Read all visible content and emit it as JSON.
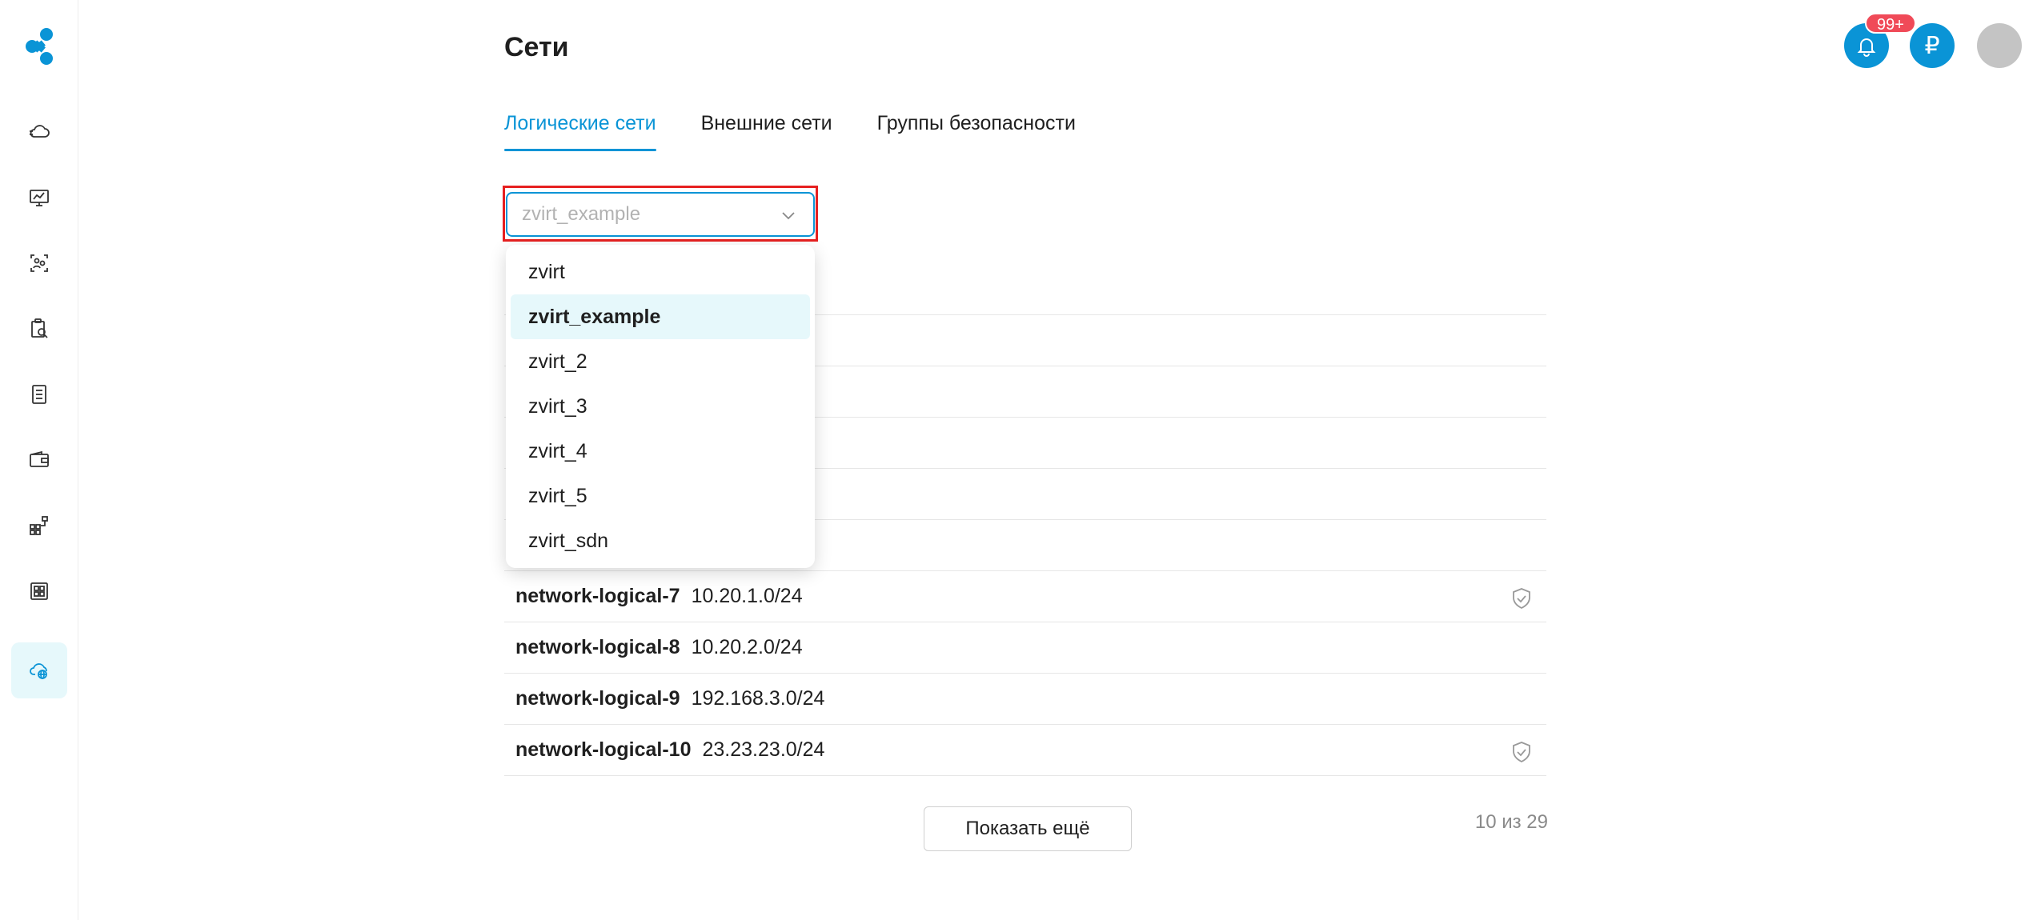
{
  "colors": {
    "accent": "#0a94d6",
    "badge": "#f04a58",
    "active_nav_bg": "#e6f8fb",
    "highlight": "#e62020"
  },
  "sidebar": {
    "logo_icon": "molecule-logo-icon",
    "items": [
      {
        "icon": "cloud-servers-icon"
      },
      {
        "icon": "monitor-dashboard-icon"
      },
      {
        "icon": "users-frame-icon"
      },
      {
        "icon": "clipboard-search-icon"
      },
      {
        "icon": "document-list-icon"
      },
      {
        "icon": "wallet-icon"
      },
      {
        "icon": "network-topology-icon"
      },
      {
        "icon": "grid-dashboard-icon"
      },
      {
        "icon": "cloud-globe-icon",
        "active": true
      }
    ]
  },
  "header": {
    "title": "Сети",
    "notifications_badge": "99+",
    "balance_symbol": "₽"
  },
  "tabs": [
    {
      "label": "Логические сети",
      "active": true
    },
    {
      "label": "Внешние сети",
      "active": false
    },
    {
      "label": "Группы безопасности",
      "active": false
    }
  ],
  "select": {
    "placeholder": "zvirt_example",
    "options": [
      "zvirt",
      "zvirt_example",
      "zvirt_2",
      "zvirt_3",
      "zvirt_4",
      "zvirt_5",
      "zvirt_sdn"
    ],
    "selected": "zvirt_example"
  },
  "networks": [
    {
      "name": "",
      "cidr": "",
      "shield": false
    },
    {
      "name": "",
      "cidr": "",
      "shield": false
    },
    {
      "name": "",
      "cidr": "",
      "shield": false
    },
    {
      "name": "",
      "cidr": "",
      "shield": false
    },
    {
      "name": "",
      "cidr": "",
      "shield": false
    },
    {
      "name": "",
      "cidr": "",
      "shield": false
    },
    {
      "name": "network-logical-7",
      "cidr": "10.20.1.0/24",
      "shield": true
    },
    {
      "name": "network-logical-8",
      "cidr": "10.20.2.0/24",
      "shield": false
    },
    {
      "name": "network-logical-9",
      "cidr": "192.168.3.0/24",
      "shield": false
    },
    {
      "name": "network-logical-10",
      "cidr": "23.23.23.0/24",
      "shield": true
    }
  ],
  "footer": {
    "show_more_label": "Показать ещё",
    "counter": "10 из 29"
  }
}
